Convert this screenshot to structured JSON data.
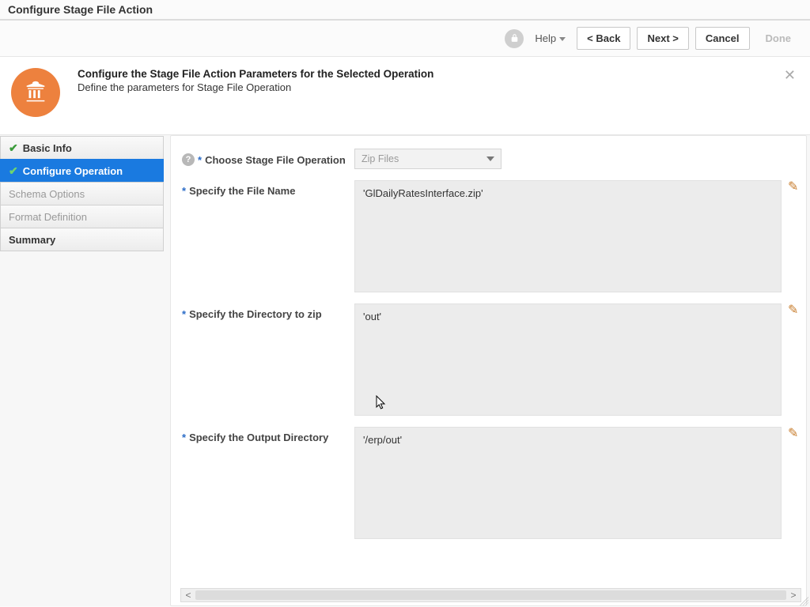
{
  "window": {
    "title": "Configure Stage File Action"
  },
  "toolbar": {
    "help_label": "Help",
    "back_label": "<  Back",
    "next_label": "Next  >",
    "cancel_label": "Cancel",
    "done_label": "Done"
  },
  "header": {
    "title": "Configure the Stage File Action Parameters for the Selected Operation",
    "subtitle": "Define the parameters for Stage File Operation"
  },
  "nav": {
    "items": [
      {
        "label": "Basic Info",
        "state": "completed"
      },
      {
        "label": "Configure Operation",
        "state": "active"
      },
      {
        "label": "Schema Options",
        "state": "dim"
      },
      {
        "label": "Format Definition",
        "state": "dim"
      },
      {
        "label": "Summary",
        "state": "bold"
      }
    ]
  },
  "form": {
    "operation_label": "Choose Stage File Operation",
    "operation_value": "Zip Files",
    "file_name_label": "Specify the File Name",
    "file_name_value": "'GlDailyRatesInterface.zip'",
    "dir_to_zip_label": "Specify the Directory to zip",
    "dir_to_zip_value": "'out'",
    "output_dir_label": "Specify the Output Directory",
    "output_dir_value": "'/erp/out'"
  }
}
